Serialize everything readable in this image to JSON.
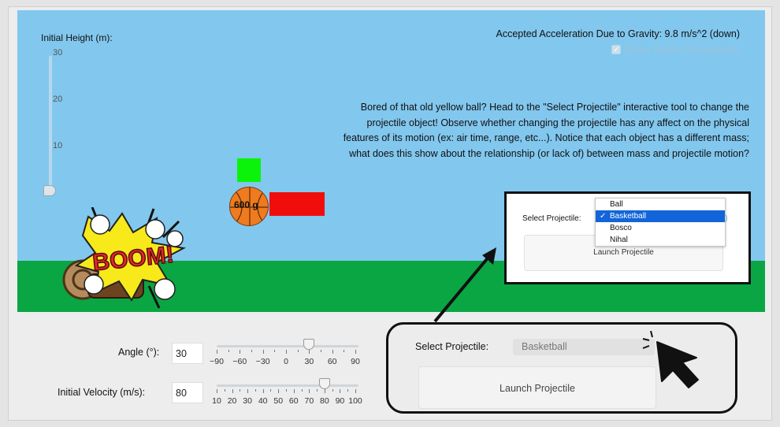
{
  "height_slider": {
    "label": "Initial Height (m):",
    "ticks": [
      "30",
      "20",
      "10"
    ]
  },
  "gravity_text": "Accepted Acceleration Due to Gravity: 9.8 m/s^2 (down)",
  "vector_components": {
    "label": "Show Vector Components",
    "checked": true
  },
  "instructions": "Bored of that old yellow ball? Head to the \"Select Projectile\" interactive tool to change the projectile object! Observe whether changing the projectile has any affect on the physical features of its motion (ex: air time, range, etc...). Notice that each object has a different mass; what does this show about the relationship (or lack of) between mass and projectile motion?",
  "projectile": {
    "mass_label": "600 g"
  },
  "boom_text": "BOOM!",
  "zoom_popup": {
    "select_label": "Select Projectile:",
    "options": [
      "Ball",
      "Basketball",
      "Bosco",
      "Nihal"
    ],
    "selected": "Basketball",
    "checkmark": "✓",
    "launch_label": "Launch Projectile"
  },
  "angle": {
    "label": "Angle (°):",
    "value": "30",
    "tick_labels": [
      "−90",
      "−60",
      "−30",
      "0",
      "30",
      "60",
      "90"
    ],
    "min": -90,
    "max": 90
  },
  "velocity": {
    "label": "Initial Velocity (m/s):",
    "value": "80",
    "tick_labels": [
      "10",
      "20",
      "30",
      "40",
      "50",
      "60",
      "70",
      "80",
      "90",
      "100"
    ],
    "min": 10,
    "max": 100
  },
  "select_panel": {
    "label": "Select Projectile:",
    "value": "Basketball",
    "launch_label": "Launch Projectile"
  },
  "colors": {
    "sky": "#82c7ee",
    "ground": "#0aa644",
    "green_box": "#0bf20b",
    "red_box": "#f20d0d",
    "ball": "#ef7b1e",
    "selected_item": "#1265d8"
  }
}
